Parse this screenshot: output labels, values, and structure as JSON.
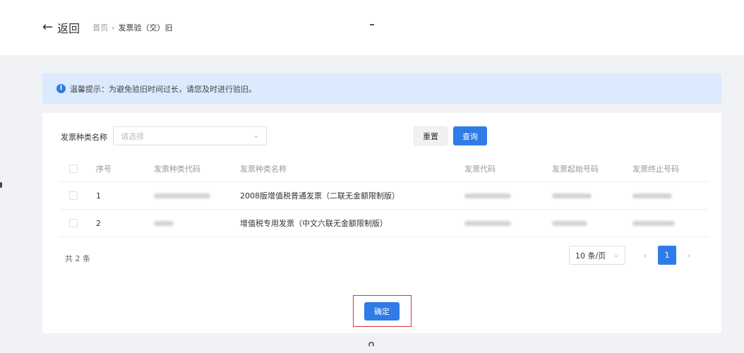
{
  "header": {
    "back_label": "返回",
    "breadcrumb": {
      "home": "首页",
      "separator": "›",
      "current": "发票验（交）旧"
    }
  },
  "alert": {
    "icon": "info-icon",
    "text": "温馨提示：为避免验旧时间过长，请您及时进行验旧。"
  },
  "filter": {
    "label": "发票种类名称",
    "select_placeholder": "请选择",
    "reset_label": "重置",
    "query_label": "查询"
  },
  "table": {
    "columns": [
      "序号",
      "发票种类代码",
      "发票种类名称",
      "发票代码",
      "发票起始号码",
      "发票终止号码"
    ],
    "rows": [
      {
        "index": "1",
        "name": "2008版增值税普通发票（二联无金额限制版）"
      },
      {
        "index": "2",
        "name": "增值税专用发票（中文六联无金额限制版）"
      }
    ]
  },
  "pagination": {
    "total": "共 2 条",
    "page_size": "10 条/页",
    "current_page": "1"
  },
  "confirm_label": "确定",
  "colors": {
    "primary": "#2f7be7",
    "alert_bg": "#dbeafc",
    "highlight": "#d9333a"
  }
}
